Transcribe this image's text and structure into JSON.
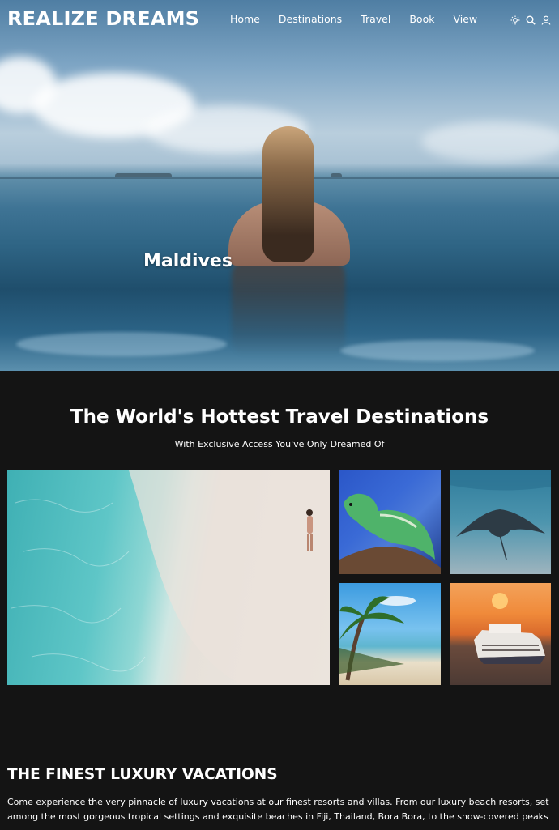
{
  "brand": {
    "logo_text": "REALIZE DREAMS"
  },
  "nav": {
    "items": [
      {
        "label": "Home"
      },
      {
        "label": "Destinations"
      },
      {
        "label": "Travel"
      },
      {
        "label": "Book"
      },
      {
        "label": "View"
      }
    ],
    "icons": [
      "sun-icon",
      "search-icon",
      "user-icon"
    ]
  },
  "hero": {
    "caption": "Maldives"
  },
  "destinations": {
    "title": "The World's Hottest Travel Destinations",
    "subtitle": "With Exclusive Access You've Only Dreamed Of"
  },
  "luxury": {
    "title": "THE FINEST LUXURY VACATIONS",
    "text": "Come experience the very pinnacle of luxury vacations at our finest resorts and villas. From our luxury beach resorts, set among the most gorgeous tropical settings and exquisite beaches in Fiji, Thailand, Bora Bora, to the snow-covered peaks"
  },
  "colors": {
    "page_bg": "#141414",
    "text": "#ffffff"
  }
}
